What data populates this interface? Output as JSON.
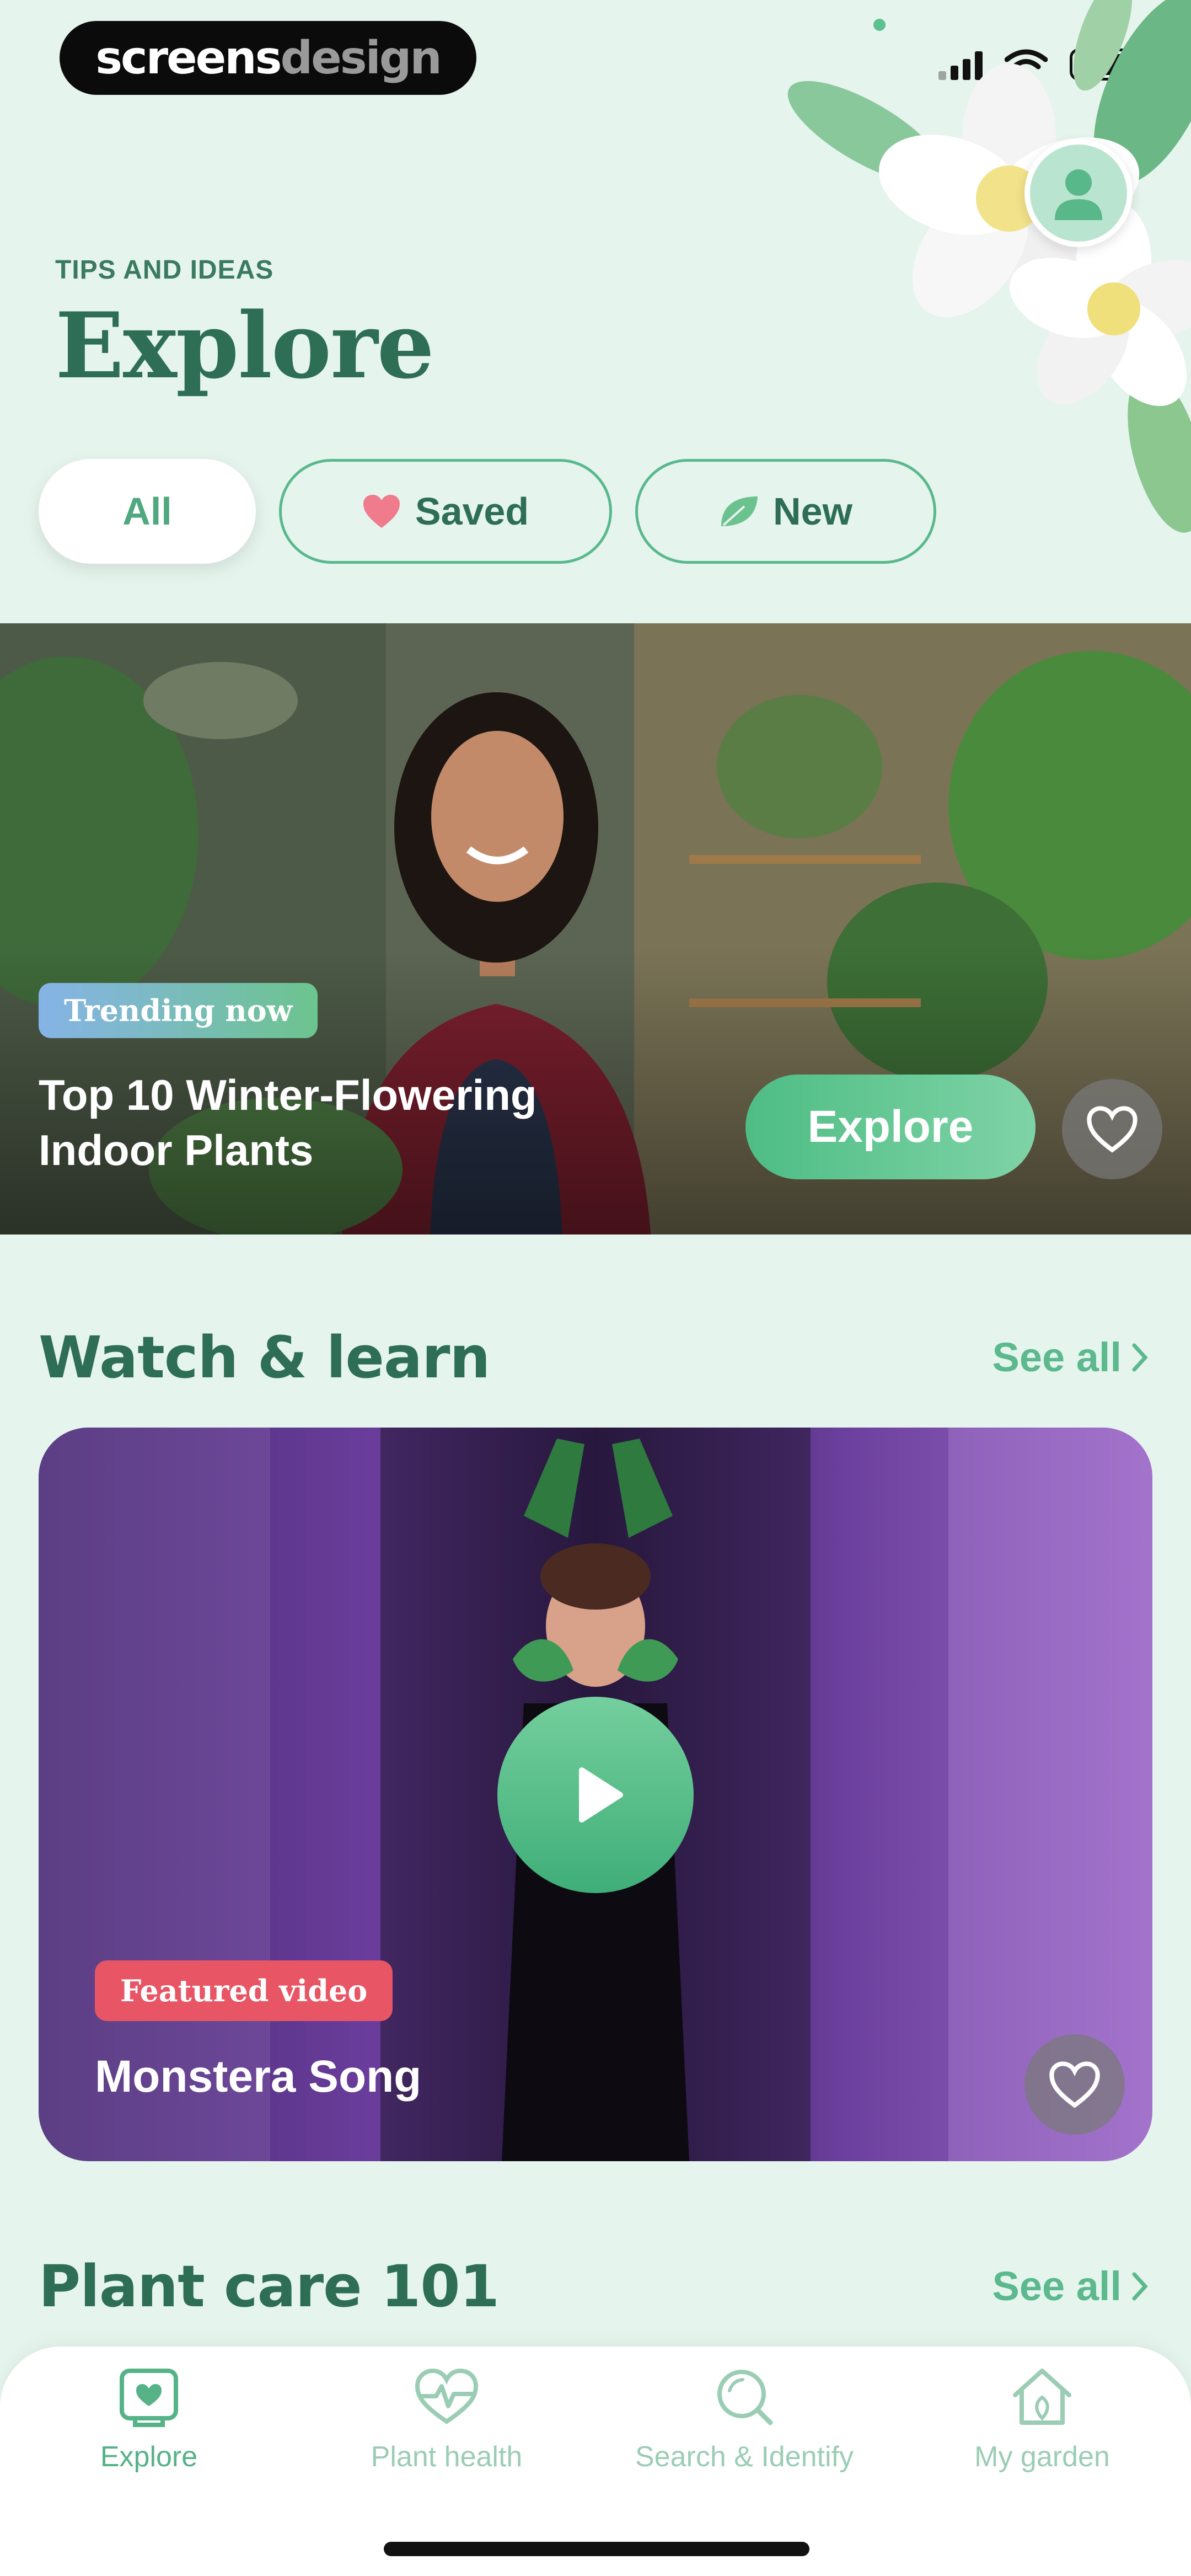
{
  "watermark": {
    "part1": "screens",
    "part2": "design"
  },
  "header": {
    "eyebrow": "TIPS AND IDEAS",
    "title": "Explore"
  },
  "filters": [
    {
      "label": "All",
      "icon": "none",
      "active": true
    },
    {
      "label": "Saved",
      "icon": "heart-icon",
      "active": false
    },
    {
      "label": "New",
      "icon": "leaf-icon",
      "active": false
    }
  ],
  "hero": {
    "badge": "Trending now",
    "title": "Top 10 Winter-Flowering Indoor Plants",
    "cta": "Explore"
  },
  "watch": {
    "title": "Watch & learn",
    "see_all": "See all",
    "video": {
      "badge": "Featured video",
      "title": "Monstera Song"
    }
  },
  "care": {
    "title": "Plant care 101",
    "see_all": "See all"
  },
  "nav": {
    "explore": "Explore",
    "health": "Plant health",
    "search": "Search & Identify",
    "garden": "My garden"
  },
  "colors": {
    "background": "#e6f4ee",
    "primary_text": "#2d6e55",
    "accent": "#55b387",
    "featured_badge": "#e85565"
  }
}
